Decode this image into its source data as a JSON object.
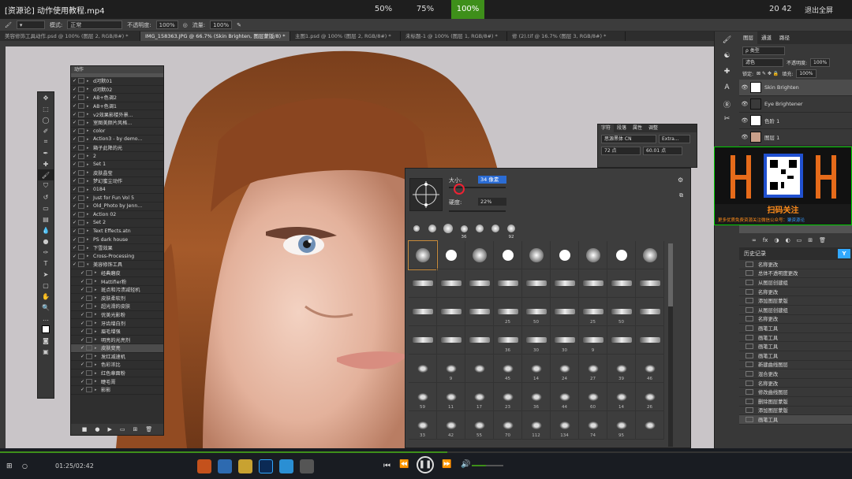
{
  "player": {
    "title": "[资源论] 动作使用教程.mp4",
    "zoom_options": [
      "50%",
      "75%",
      "100%"
    ],
    "active_zoom": "100%",
    "clock": "20 42",
    "exit_label": "退出全屏",
    "time": "01:25/02:42"
  },
  "options_bar": {
    "mode_label": "模式:",
    "mode_value": "正常",
    "opacity_label": "不透明度:",
    "opacity_value": "100%",
    "flow_label": "流量:",
    "flow_value": "100%"
  },
  "doc_tabs": [
    "美容修饰工具动作.psd @ 100% (图层 2, RGB/8#) *",
    "IMG_158363.JPG @ 66.7% (Skin Brighten, 图层蒙版/8) *",
    "主图1.psd @ 100% (图层 2, RGB/8#) *",
    "未标题-1 @ 100% (图层 1, RGB/8#) *",
    "修 (2).tif @ 16.7% (图层 3, RGB/8#) *"
  ],
  "actions_panel": {
    "title": "动作",
    "items": [
      {
        "label": "d河默01",
        "level": 0
      },
      {
        "label": "d河默02",
        "level": 0
      },
      {
        "label": "AB+色调2",
        "level": 0
      },
      {
        "label": "AB+色调1",
        "level": 0
      },
      {
        "label": "v2效果影楼外景...",
        "level": 0
      },
      {
        "label": "室图美颜片风格...",
        "level": 0
      },
      {
        "label": "color",
        "level": 0
      },
      {
        "label": "Action3 - by demo...",
        "level": 0
      },
      {
        "label": "箱子此降的光",
        "level": 0
      },
      {
        "label": "2",
        "level": 0
      },
      {
        "label": "Set 1",
        "level": 0
      },
      {
        "label": "皮肤晶莹",
        "level": 0
      },
      {
        "label": "梦幻蜜尘动作",
        "level": 0
      },
      {
        "label": "0184",
        "level": 0
      },
      {
        "label": "Just for Fun Vol 5",
        "level": 0
      },
      {
        "label": "Old_Photo by Jenn...",
        "level": 0
      },
      {
        "label": "Action 02",
        "level": 0
      },
      {
        "label": "Set 2",
        "level": 0
      },
      {
        "label": "Text Effects.atn",
        "level": 0
      },
      {
        "label": "PS dark house",
        "level": 0
      },
      {
        "label": "下雪效果",
        "level": 0
      },
      {
        "label": "Cross-Processing",
        "level": 0
      },
      {
        "label": "美容修饰工具",
        "level": 0
      },
      {
        "label": "经典磨皮",
        "level": 1
      },
      {
        "label": "Mattifier粉",
        "level": 1
      },
      {
        "label": "斑点和污渍减轻机",
        "level": 1
      },
      {
        "label": "皮肤柔软剂",
        "level": 1
      },
      {
        "label": "超光滑的皮肤",
        "level": 1
      },
      {
        "label": "优美光影粉",
        "level": 1
      },
      {
        "label": "牙齿增白剂",
        "level": 1
      },
      {
        "label": "眉毛增强",
        "level": 1
      },
      {
        "label": "明亮的光亮剂",
        "level": 1
      },
      {
        "label": "皮肤变亮",
        "level": 1
      },
      {
        "label": "发红减速机",
        "level": 1
      },
      {
        "label": "色彩浓比",
        "level": 1
      },
      {
        "label": "红色章面粉",
        "level": 1
      },
      {
        "label": "睫毛膏",
        "level": 1
      },
      {
        "label": "影影",
        "level": 1
      }
    ]
  },
  "brush_picker": {
    "size_label": "大小:",
    "size_value": "34 像素",
    "hardness_label": "硬度:",
    "hardness_value": "22%",
    "recent_sizes": [
      "",
      "",
      "",
      "36",
      "",
      "",
      "92"
    ],
    "row_numbers": [
      [
        "",
        "",
        "",
        "",
        "",
        "",
        "",
        "",
        ""
      ],
      [
        "",
        "",
        "",
        "",
        "",
        "",
        "",
        "",
        ""
      ],
      [
        "",
        "",
        "",
        "25",
        "50",
        "",
        "25",
        "50",
        ""
      ],
      [
        "",
        "",
        "",
        "36",
        "30",
        "30",
        "9",
        "",
        ""
      ],
      [
        "",
        "9",
        "",
        "45",
        "14",
        "24",
        "27",
        "39",
        "46"
      ],
      [
        "59",
        "11",
        "17",
        "23",
        "36",
        "44",
        "60",
        "14",
        "26"
      ],
      [
        "33",
        "42",
        "55",
        "70",
        "112",
        "134",
        "74",
        "95",
        ""
      ]
    ]
  },
  "char_panel": {
    "tabs": [
      "字符",
      "段落",
      "属性",
      "调整"
    ],
    "font_value": "思源黑体 CN",
    "style_value": "Extra...",
    "size_value": "72 点",
    "leading_value": "60.01 点"
  },
  "layers_panel": {
    "tabs": [
      "图层",
      "通道",
      "路径"
    ],
    "kind_value": "ρ 类型",
    "blend_value": "滤色",
    "opacity_label": "不透明度:",
    "opacity_value": "100%",
    "lock_label": "锁定:",
    "fill_label": "填充:",
    "fill_value": "100%",
    "layers": [
      {
        "name": "Skin Brighten",
        "selected": true
      },
      {
        "name": "Eye Brightener",
        "selected": false
      },
      {
        "name": "色阶 1",
        "selected": false
      },
      {
        "name": "图层 1",
        "selected": false
      }
    ]
  },
  "promo": {
    "title": "扫码关注",
    "subtitle": "更多优质免费资源关注微信公众号：",
    "highlight": "聚资源论"
  },
  "history_panel": {
    "title": "历史记录",
    "items": [
      "名称更改",
      "总体不透明度更改",
      "从图层创建组",
      "名称更改",
      "添加图层蒙版",
      "从图层创建组",
      "名称更改",
      "画笔工具",
      "画笔工具",
      "画笔工具",
      "画笔工具",
      "新建曲线图层",
      "混合更改",
      "名称更改",
      "修改曲线图层",
      "删除图层蒙版",
      "添加图层蒙版",
      "画笔工具"
    ]
  },
  "colors": {
    "accent_green": "#3e8f1a",
    "ps_blue": "#31a8ff",
    "promo_orange": "#ff8c1a"
  }
}
